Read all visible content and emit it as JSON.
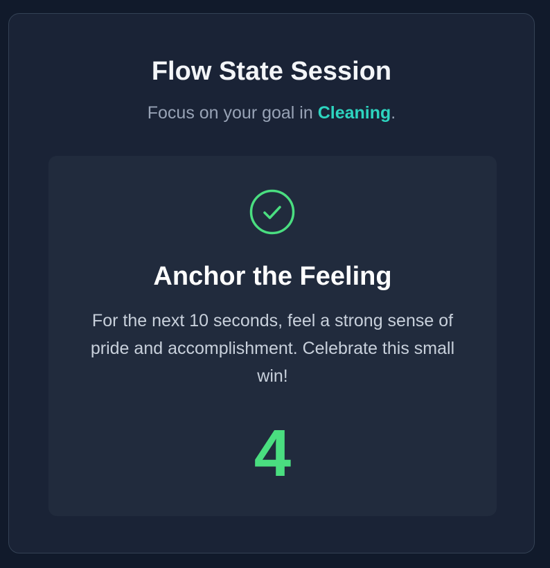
{
  "session": {
    "title": "Flow State Session",
    "subtitle_prefix": "Focus on your goal in ",
    "goal": "Cleaning",
    "subtitle_suffix": "."
  },
  "step": {
    "icon": "check-circle-icon",
    "heading": "Anchor the Feeling",
    "instruction": "For the next 10 seconds, feel a strong sense of pride and accomplishment. Celebrate this small win!",
    "countdown": "4"
  },
  "colors": {
    "background": "#111a2b",
    "card": "#1a2336",
    "panel": "#212b3d",
    "accent_teal": "#2dd4bf",
    "accent_green": "#4ade80"
  }
}
